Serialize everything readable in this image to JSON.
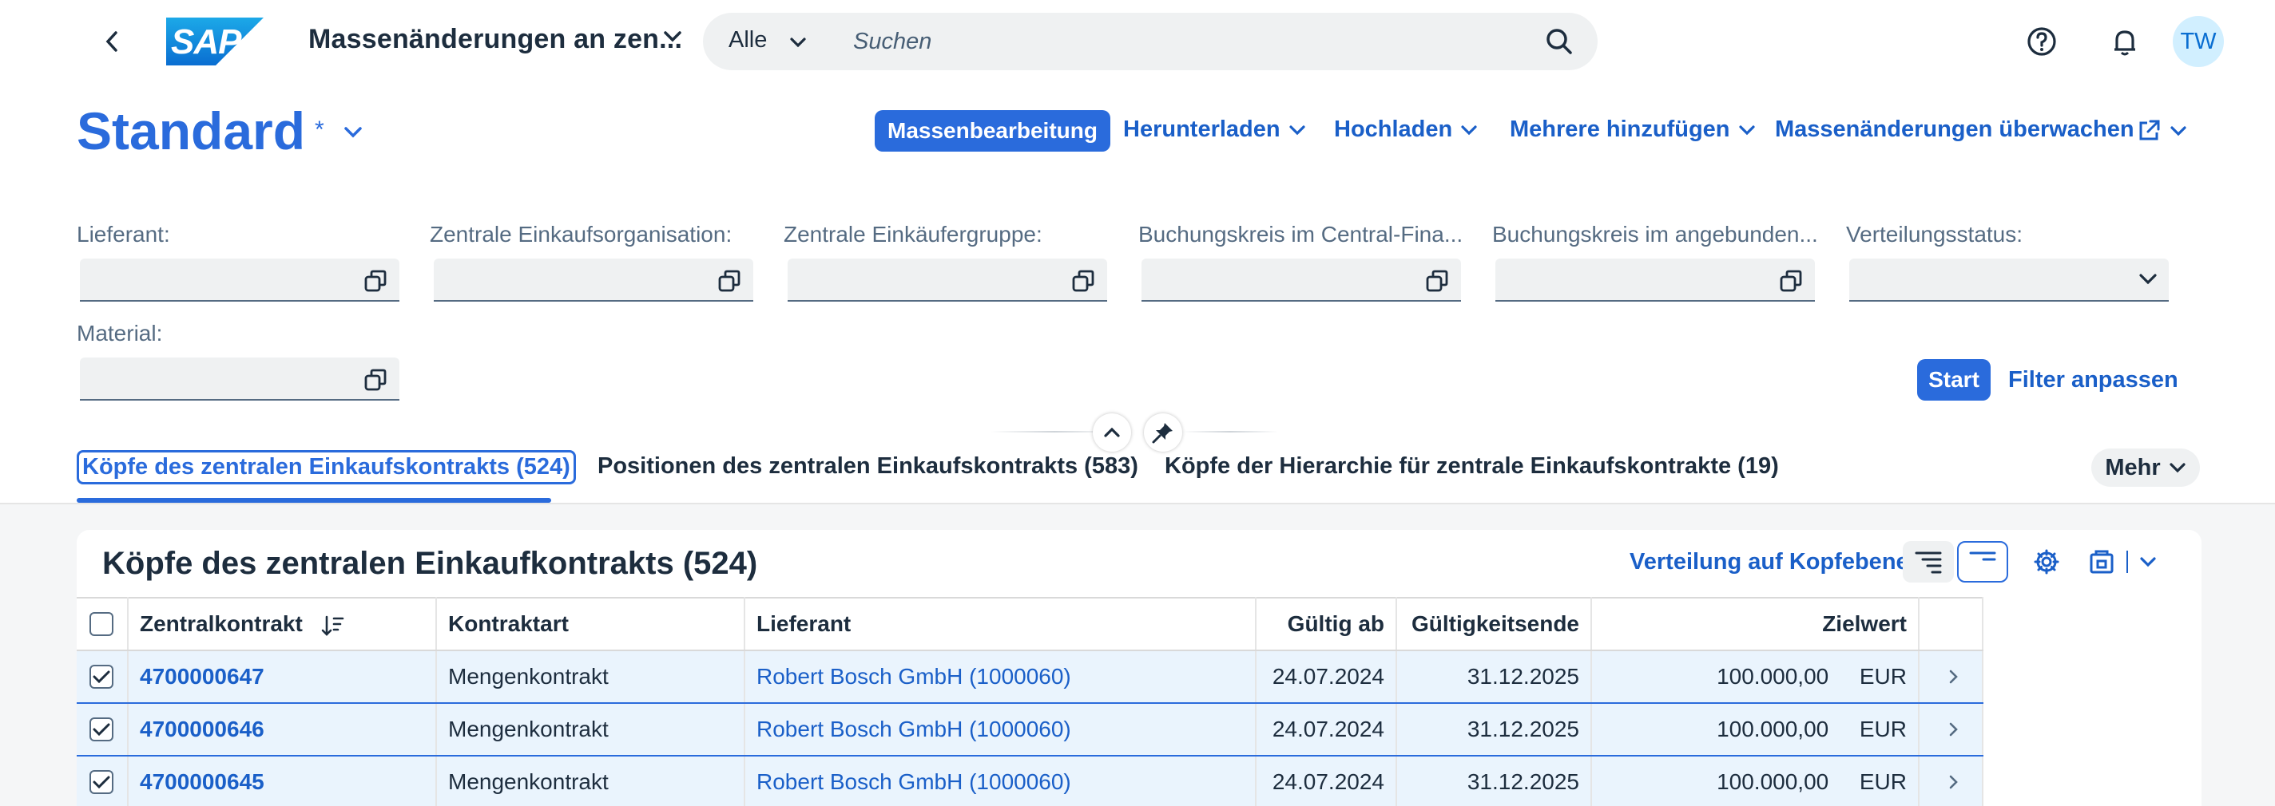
{
  "shell": {
    "logo_text": "SAP",
    "app_title": "Massenänderungen an zen...",
    "search_scope": "Alle",
    "search_placeholder": "Suchen",
    "avatar_initials": "TW"
  },
  "header": {
    "variant_name": "Standard",
    "variant_modified": "*",
    "actions": {
      "mass_edit": "Massenbearbeitung",
      "download": "Herunterladen",
      "upload": "Hochladen",
      "add_multiple": "Mehrere hinzufügen",
      "monitor": "Massenänderungen überwachen"
    }
  },
  "filters": {
    "supplier": "Lieferant:",
    "central_purch_org": "Zentrale Einkaufsorganisation:",
    "central_purch_group": "Zentrale Einkäufergruppe:",
    "company_code_central": "Buchungskreis im Central-Fina...",
    "company_code_connected": "Buchungskreis im angebunden...",
    "distribution_status": "Verteilungsstatus:",
    "material": "Material:",
    "go": "Start",
    "adapt": "Filter anpassen"
  },
  "tabs": [
    {
      "label": "Köpfe des zentralen Einkaufskontrakts (524)"
    },
    {
      "label": "Positionen des zentralen Einkaufskontrakts (583)"
    },
    {
      "label": "Köpfe der Hierarchie für zentrale Einkaufskontrakte (19)"
    }
  ],
  "tabs_more": "Mehr",
  "table": {
    "title": "Köpfe des zentralen Einkaufkontrakts (524)",
    "toolbar_link": "Verteilung auf Kopfebene",
    "columns": {
      "contract": "Zentralkontrakt",
      "type": "Kontraktart",
      "supplier": "Lieferant",
      "valid_from": "Gültig ab",
      "valid_to": "Gültigkeitsende",
      "target": "Zielwert"
    },
    "rows": [
      {
        "contract": "4700000647",
        "type": "Mengenkontrakt",
        "supplier": "Robert Bosch GmbH (1000060)",
        "valid_from": "24.07.2024",
        "valid_to": "31.12.2025",
        "target": "100.000,00",
        "currency": "EUR"
      },
      {
        "contract": "4700000646",
        "type": "Mengenkontrakt",
        "supplier": "Robert Bosch GmbH (1000060)",
        "valid_from": "24.07.2024",
        "valid_to": "31.12.2025",
        "target": "100.000,00",
        "currency": "EUR"
      },
      {
        "contract": "4700000645",
        "type": "Mengenkontrakt",
        "supplier": "Robert Bosch GmbH (1000060)",
        "valid_from": "24.07.2024",
        "valid_to": "31.12.2025",
        "target": "100.000,00",
        "currency": "EUR"
      }
    ]
  },
  "colors": {
    "brand": "#2a6bdc",
    "link": "#1a5fc8",
    "selected_row": "#eaf4fd"
  }
}
